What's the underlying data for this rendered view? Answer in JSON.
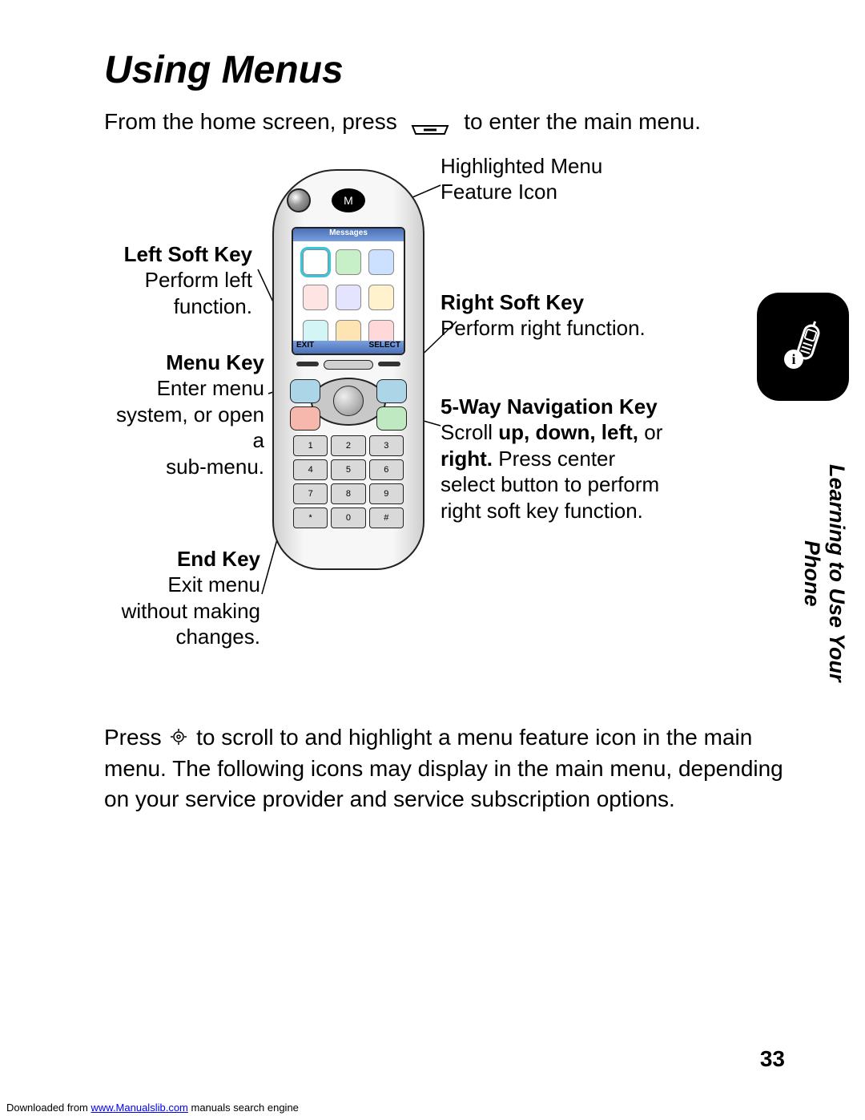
{
  "heading": "Using Menus",
  "intro": {
    "part1": "From the home screen, press ",
    "part2": " to enter the main menu."
  },
  "phone_screen": {
    "status": "Messages",
    "soft_left": "EXIT",
    "soft_right": "SELECT",
    "keypad": [
      "1",
      "2",
      "3",
      "4",
      "5",
      "6",
      "7",
      "8",
      "9",
      "*",
      "0",
      "#"
    ]
  },
  "callouts": {
    "highlighted": "Highlighted Menu Feature Icon",
    "left_soft_key": {
      "title": "Left Soft Key",
      "body": "Perform left function."
    },
    "right_soft_key": {
      "title": "Right Soft Key",
      "body": "Perform right function."
    },
    "menu_key": {
      "title": "Menu Key",
      "body": "Enter menu system, or open a\nsub-menu."
    },
    "five_way": {
      "title": "5-Way Navigation Key",
      "scroll_prefix": "Scroll ",
      "scroll_bold1": "up, down, left,",
      "scroll_mid": " or ",
      "scroll_bold2": "right.",
      "body2": " Press center select button to perform right soft key function."
    },
    "end_key": {
      "title": "End Key",
      "body": "Exit menu without making changes."
    }
  },
  "side_tab": "Learning to Use Your Phone",
  "paragraph": {
    "p1": "Press ",
    "p2": " to scroll to and highlight a menu feature icon in the main menu. The following icons may display in the main menu, depending on your service provider and service subscription options."
  },
  "page_number": "33",
  "footer": {
    "prefix": "Downloaded from ",
    "link": "www.Manualslib.com",
    "suffix": " manuals search engine"
  }
}
